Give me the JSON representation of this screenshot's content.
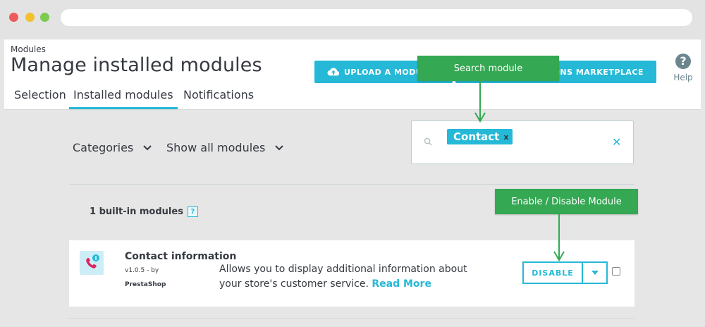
{
  "header": {
    "breadcrumb": "Modules",
    "title": "Manage installed modules",
    "tabs": [
      {
        "label": "Selection",
        "active": false
      },
      {
        "label": "Installed modules",
        "active": true
      },
      {
        "label": "Notifications",
        "active": false
      }
    ],
    "upload_button": "UPLOAD A MODULE",
    "marketplace_button": "ADDONS MARKETPLACE",
    "help_label": "Help"
  },
  "filters": {
    "categories": "Categories",
    "show_all": "Show all modules"
  },
  "search": {
    "tag": "Contact",
    "tag_close": "x",
    "clear": "✕"
  },
  "section": {
    "builtin_label": "1 built-in modules",
    "help_badge": "?"
  },
  "module": {
    "name": "Contact information",
    "version": "v1.0.5 - by",
    "author": "PrestaShop",
    "description": "Allows you to display additional information about your store's customer service.",
    "read_more": "Read More",
    "disable_button": "DISABLE"
  },
  "callouts": {
    "search": "Search module",
    "enable": "Enable / Disable Module"
  },
  "colors": {
    "accent": "#25b9d7",
    "callout": "#34a853",
    "text": "#363a41"
  }
}
